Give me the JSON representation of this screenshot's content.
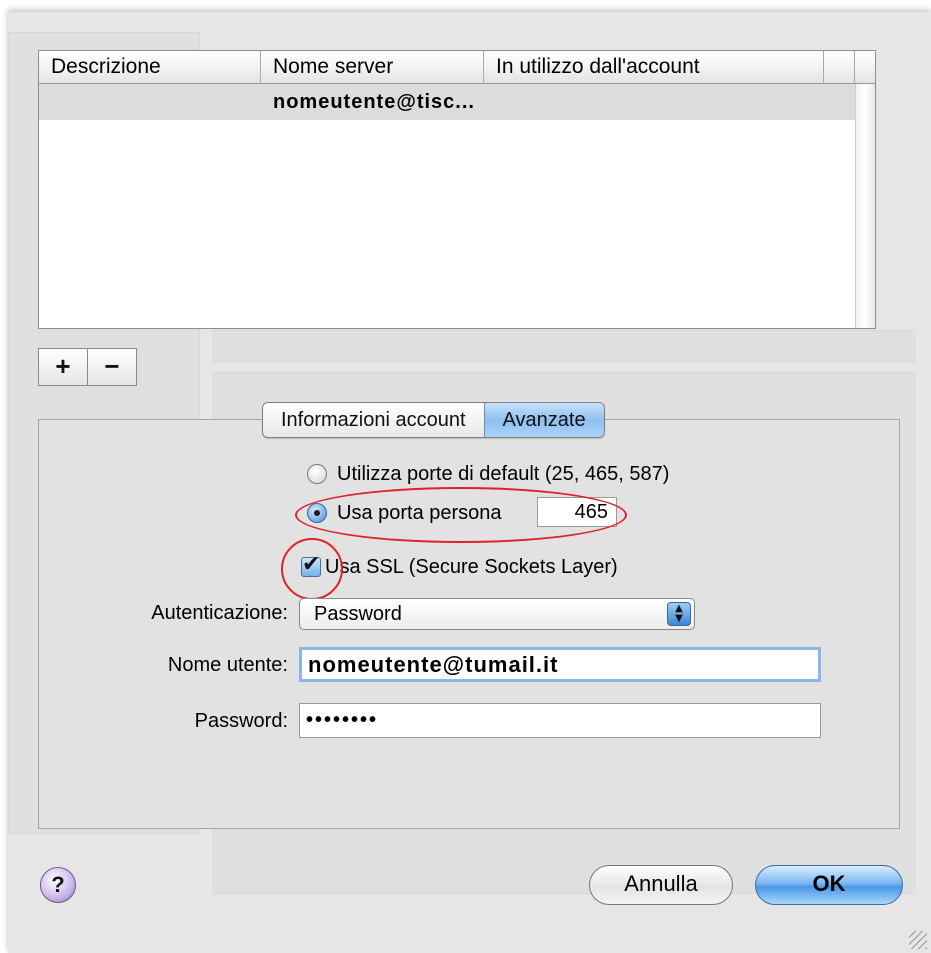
{
  "table": {
    "columns": [
      "Descrizione",
      "Nome server",
      "In utilizzo dall'account"
    ],
    "rows": [
      {
        "description": "",
        "server": "nomeutente@tisc...",
        "account": ""
      }
    ]
  },
  "list_buttons": {
    "add": "+",
    "remove": "−"
  },
  "tabs": [
    {
      "label": "Informazioni account",
      "active": false
    },
    {
      "label": "Avanzate",
      "active": true
    }
  ],
  "port": {
    "default_label": "Utilizza porte di default (25, 465, 587)",
    "default_selected": false,
    "custom_label": "Usa porta persona",
    "custom_selected": true,
    "custom_value": "465"
  },
  "ssl": {
    "label": "Usa SSL (Secure Sockets Layer)",
    "checked": true
  },
  "auth": {
    "label": "Autenticazione:",
    "value": "Password"
  },
  "user": {
    "label": "Nome utente:",
    "value": "nomeutente@tumail.it"
  },
  "password": {
    "label": "Password:",
    "value": "••••••••"
  },
  "buttons": {
    "help": "?",
    "cancel": "Annulla",
    "ok": "OK"
  },
  "colors": {
    "accent": "#7db8f3",
    "annotation": "#e0202a",
    "selected_row": "#dcdcdc"
  }
}
